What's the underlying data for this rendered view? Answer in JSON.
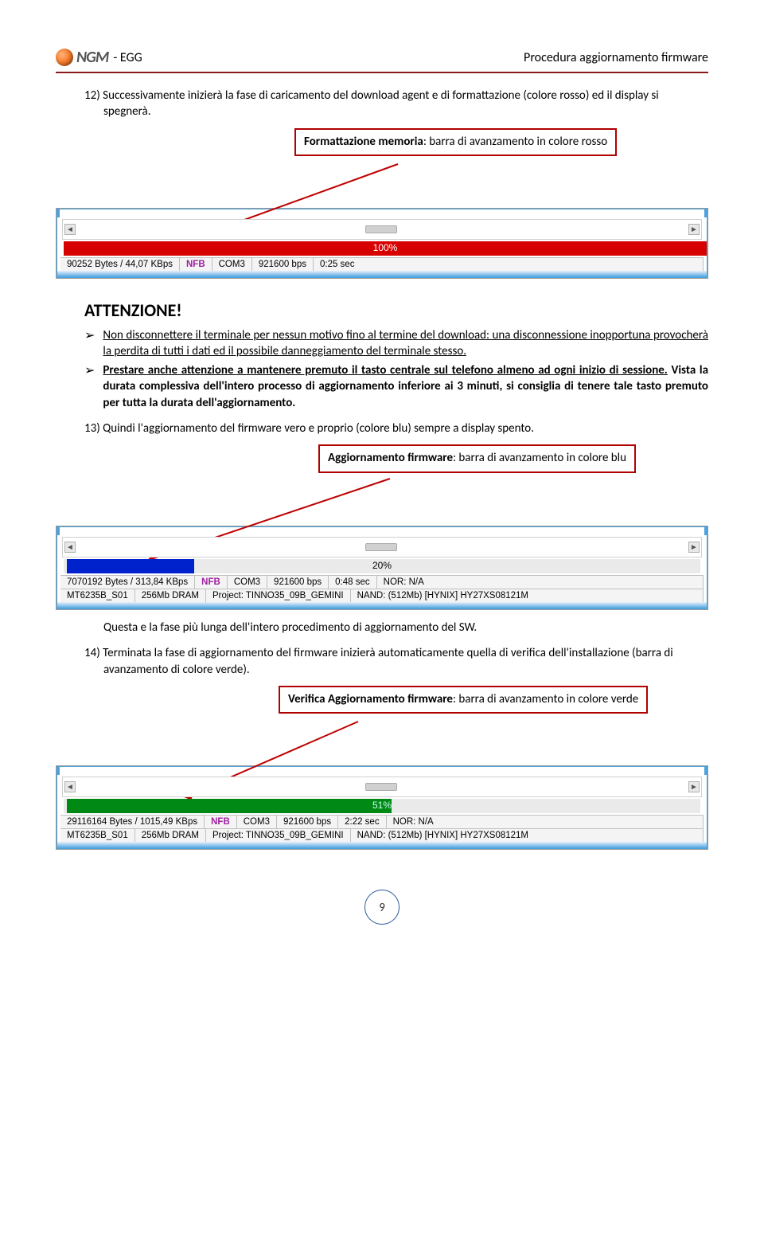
{
  "header": {
    "logo_text": "NGM",
    "suffix": "- EGG",
    "right": "Procedura aggiornamento firmware"
  },
  "step12": {
    "num": "12)",
    "text": "Successivamente inizierà la fase di caricamento del download agent e di formattazione (colore rosso) ed il display si spegnerà."
  },
  "callout1": {
    "bold": "Formattazione memoria",
    "rest": ": barra di avanzamento in colore rosso"
  },
  "fig1": {
    "percent": "100%",
    "status": {
      "bytes": "90252 Bytes / 44,07 KBps",
      "nfb": "NFB",
      "com": "COM3",
      "bps": "921600 bps",
      "time": "0:25 sec"
    }
  },
  "attention": "ATTENZIONE!",
  "bullet1": "Non disconnettere il terminale per nessun motivo fino al termine del download: una disconnessione inopportuna provocherà la perdita di tutti i dati ed il possibile danneggiamento del terminale stesso.",
  "bullet2_a": "Prestare anche attenzione a mantenere premuto il tasto centrale sul telefono almeno ad ogni inizio di sessione.",
  "bullet2_b": " Vista la durata complessiva dell'intero processo di aggiornamento inferiore ai 3 minuti, si consiglia di tenere tale tasto premuto per tutta la durata dell'aggiornamento.",
  "step13": {
    "num": "13)",
    "text": "Quindi l'aggiornamento del firmware vero e proprio (colore blu) sempre a display spento."
  },
  "callout2": {
    "bold": "Aggiornamento firmware",
    "rest": ": barra di avanzamento in colore blu"
  },
  "fig2": {
    "percent": "20%",
    "row1": {
      "bytes": "7070192 Bytes / 313,84 KBps",
      "nfb": "NFB",
      "com": "COM3",
      "bps": "921600 bps",
      "time": "0:48 sec",
      "nor": "NOR: N/A"
    },
    "row2": {
      "chip": "MT6235B_S01",
      "dram": "256Mb DRAM",
      "project": "Project: TINNO35_09B_GEMINI",
      "nand": "NAND: (512Mb) [HYNIX] HY27XS08121M"
    }
  },
  "step13_after": "Questa e la fase più lunga dell'intero procedimento di aggiornamento del SW.",
  "step14": {
    "num": "14)",
    "text": "Terminata la fase di aggiornamento del firmware inizierà automaticamente quella di verifica dell'installazione (barra di avanzamento di colore verde)."
  },
  "callout3": {
    "bold": "Verifica Aggiornamento firmware",
    "rest": ": barra di avanzamento in colore verde"
  },
  "fig3": {
    "percent": "51%",
    "row1": {
      "bytes": "29116164 Bytes / 1015,49 KBps",
      "nfb": "NFB",
      "com": "COM3",
      "bps": "921600 bps",
      "time": "2:22 sec",
      "nor": "NOR: N/A"
    },
    "row2": {
      "chip": "MT6235B_S01",
      "dram": "256Mb DRAM",
      "project": "Project: TINNO35_09B_GEMINI",
      "nand": "NAND: (512Mb) [HYNIX] HY27XS08121M"
    }
  },
  "page_number": "9"
}
